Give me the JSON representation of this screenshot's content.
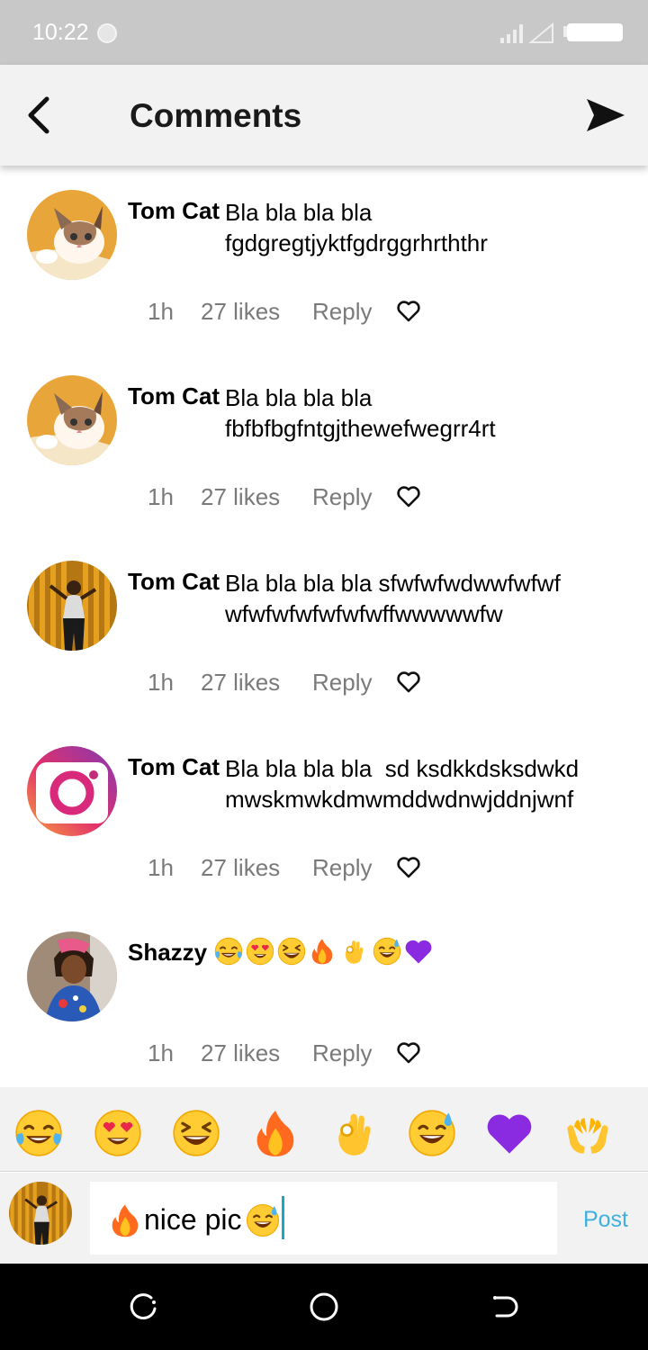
{
  "status_bar": {
    "time": "10:22"
  },
  "header": {
    "title": "Comments",
    "back_icon": "back-arrow-icon",
    "send_icon": "send-icon"
  },
  "comments": [
    {
      "user": "Tom Cat",
      "text": "Bla bla bla bla fgdgregtjyktfgdrggrhrththr",
      "time": "1h",
      "likes": "27 likes",
      "reply": "Reply",
      "avatar": "cat-photo"
    },
    {
      "user": "Tom Cat",
      "text": "Bla bla bla bla fbfbfbgfntgjthewefwegrr4rt",
      "time": "1h",
      "likes": "27 likes",
      "reply": "Reply",
      "avatar": "cat-photo"
    },
    {
      "user": "Tom Cat",
      "text": "Bla bla bla bla sfwfwfwdwwfwfwf wfwfwfwfwfwfwffwwwwwfw",
      "time": "1h",
      "likes": "27 likes",
      "reply": "Reply",
      "avatar": "woman-photo"
    },
    {
      "user": "Tom Cat",
      "text": "Bla bla bla bla  sd ksdkkdsksdwkd mwskmwkdmwmddwdnwjddnjwnf",
      "time": "1h",
      "likes": "27 likes",
      "reply": "Reply",
      "avatar": "instagram-logo"
    },
    {
      "user": "Shazzy",
      "text": "",
      "emojis": [
        "tears-of-joy",
        "heart-eyes",
        "grinning-squint",
        "fire",
        "ok-hand",
        "sweat-smile",
        "purple-heart"
      ],
      "time": "1h",
      "likes": "27 likes",
      "reply": "Reply",
      "avatar": "woman-selfie-photo"
    }
  ],
  "emoji_bar": [
    "tears-of-joy",
    "heart-eyes",
    "grinning-squint",
    "fire",
    "ok-hand",
    "sweat-smile",
    "purple-heart",
    "open-hands"
  ],
  "input": {
    "prefix_emoji": "fire",
    "text": "nice pic",
    "suffix_emoji": "sweat-smile",
    "post_label": "Post"
  },
  "nav_bar": [
    "recent-apps-icon",
    "home-icon",
    "back-icon"
  ],
  "colors": {
    "header_bg": "#f2f2f2",
    "status_bar_bg": "#c8c8c8",
    "post_blue": "#3fb0e0",
    "meta_gray": "#7a7a7a",
    "caret": "#18a8c8"
  }
}
